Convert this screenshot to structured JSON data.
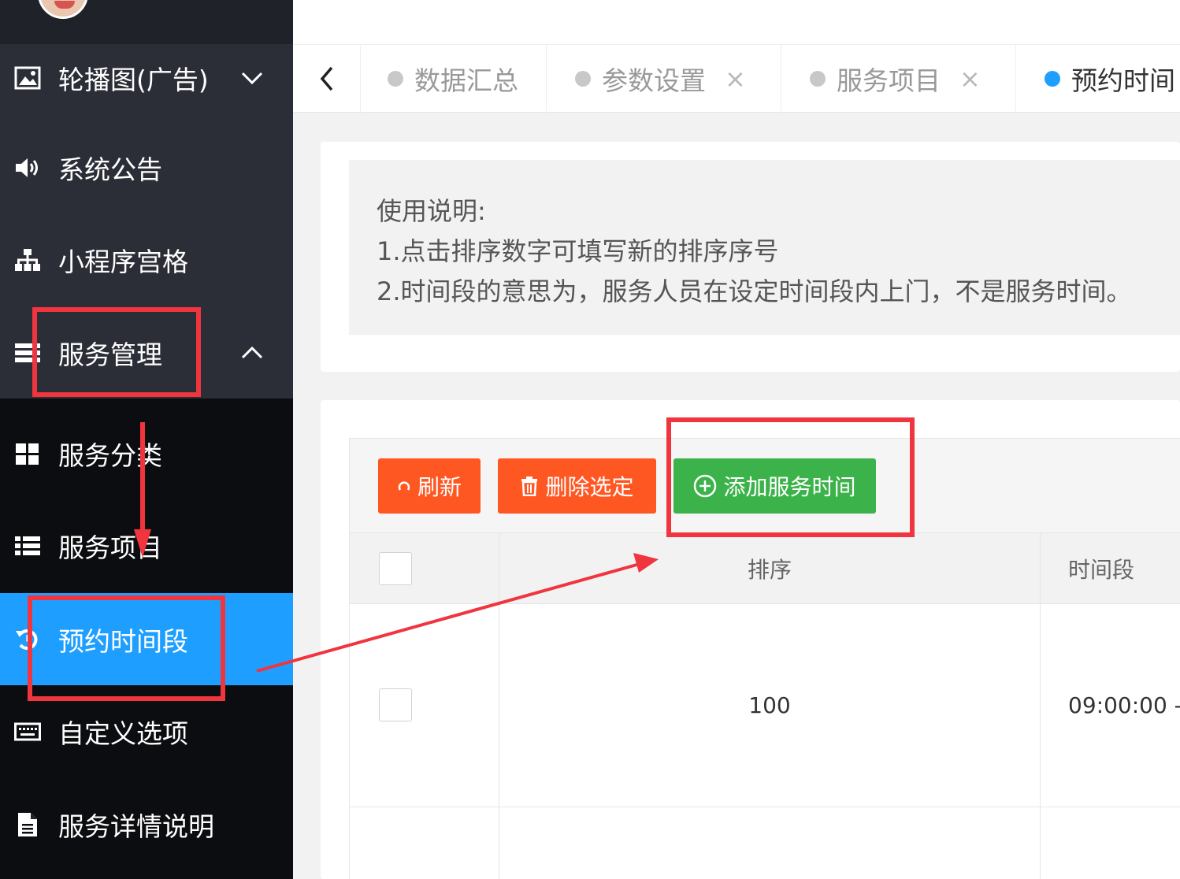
{
  "sidebar": {
    "items": [
      {
        "label": "轮播图(广告)",
        "icon": "image-icon"
      },
      {
        "label": "系统公告",
        "icon": "speaker-icon"
      },
      {
        "label": "小程序宫格",
        "icon": "sitemap-icon"
      },
      {
        "label": "服务管理",
        "icon": "list-bars-icon"
      },
      {
        "label": "服务分类",
        "icon": "grid-icon"
      },
      {
        "label": "服务项目",
        "icon": "list-icon"
      },
      {
        "label": "预约时间段",
        "icon": "history-icon"
      },
      {
        "label": "自定义选项",
        "icon": "keyboard-icon"
      },
      {
        "label": "服务详情说明",
        "icon": "file-icon"
      }
    ]
  },
  "tabs": [
    {
      "label": "数据汇总"
    },
    {
      "label": "参数设置",
      "close": "×"
    },
    {
      "label": "服务项目",
      "close": "×"
    },
    {
      "label": "预约时间"
    }
  ],
  "notice": {
    "title": "使用说明:",
    "line1": "1.点击排序数字可填写新的排序序号",
    "line2": "2.时间段的意思为，服务人员在设定时间段内上门，不是服务时间。"
  },
  "toolbar": {
    "refresh": "刷新",
    "delete": "删除选定",
    "add": "添加服务时间"
  },
  "table": {
    "headers": {
      "sort": "排序",
      "time": "时间段"
    },
    "rows": [
      {
        "sort": "100",
        "time": "09:00:00 -"
      }
    ]
  },
  "colors": {
    "accent": "#1e9fff",
    "danger": "#ff5722",
    "success": "#3cb34a",
    "annotation": "#f0353f"
  }
}
